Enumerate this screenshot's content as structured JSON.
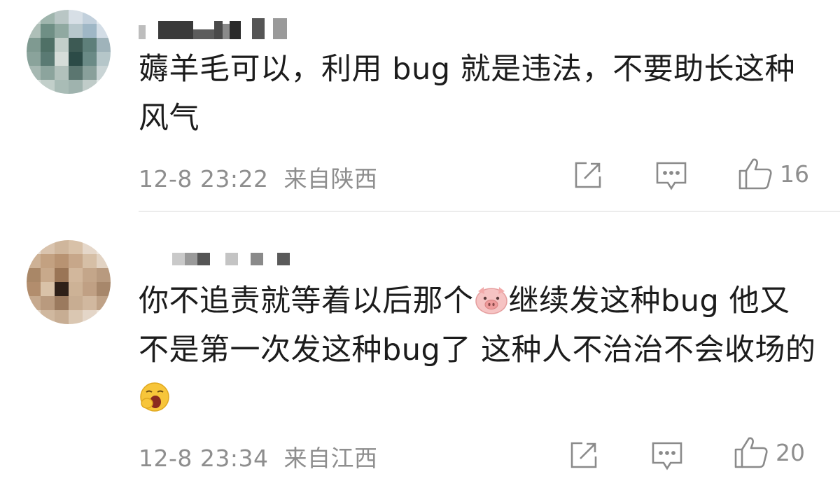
{
  "comments": [
    {
      "text": "薅羊毛可以，利用 bug 就是违法，不要助长这种风气",
      "time": "12-8 23:22",
      "location": "来自陕西",
      "likes": "16"
    },
    {
      "text_part1": "你不追责就等着以后那个",
      "text_part2": "继续发这种bug 他又不是第一次发这种bug了 这种人不治治不会收场的",
      "time": "12-8 23:34",
      "location": "来自江西",
      "likes": "20"
    }
  ],
  "icons": [
    "share-icon",
    "reply-icon",
    "like-icon",
    "pig-emoji",
    "yawn-emoji"
  ],
  "colors": {
    "meta_text": "#8e8e8e",
    "icon": "#8a8a8a",
    "divider": "#ececec"
  }
}
